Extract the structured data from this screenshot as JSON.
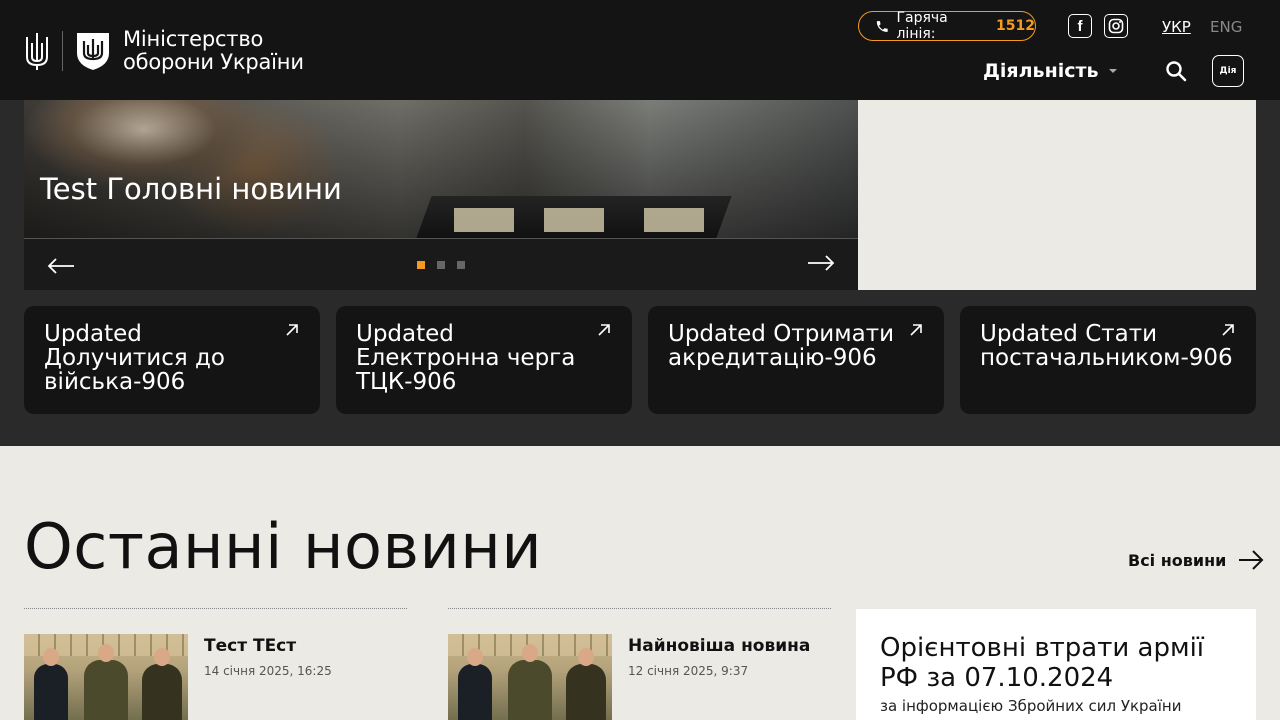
{
  "header": {
    "brand_line1": "Міністерство",
    "brand_line2": "оборони України",
    "hotline_label": "Гаряча лінія:",
    "hotline_number": "1512",
    "lang_ukr": "УКР",
    "lang_eng": "ENG",
    "nav_activity": "Діяльність",
    "diia_label": "Дія",
    "facebook_glyph": "f"
  },
  "hero": {
    "title": "Test Головні новини",
    "slide_count": 3,
    "active_slide": 1
  },
  "quick_links": [
    {
      "label": "Updated Долучитися до війська-906"
    },
    {
      "label": "Updated Електронна черга ТЦК-906"
    },
    {
      "label": "Updated Отримати акредитацію-906"
    },
    {
      "label": "Updated Стати постачальником-906"
    }
  ],
  "news": {
    "section_title": "Останні новини",
    "all_news_label": "Всі новини",
    "items": [
      {
        "headline": "Тест ТЕст",
        "date": "14 січня 2025, 16:25"
      },
      {
        "headline": "Найновіша новина",
        "date": "12 січня 2025, 9:37"
      }
    ]
  },
  "losses": {
    "title": "Орієнтовні втрати армії РФ за 07.10.2024",
    "subtitle": "за інформацією Збройних сил України"
  },
  "colors": {
    "accent": "#f39a1f",
    "header_bg": "#141414",
    "page_bg": "#eceae5"
  }
}
